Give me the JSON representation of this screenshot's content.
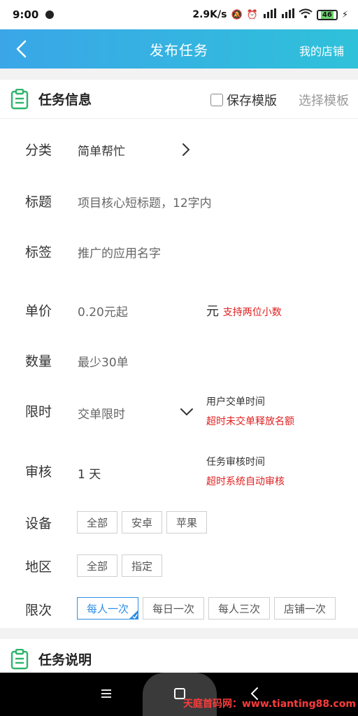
{
  "status_bar": {
    "time": "9:00",
    "speed": "2.9K/s",
    "battery": "46",
    "icons": [
      "dot-icon",
      "mute-icon",
      "alarm-icon",
      "signal-hd-icon",
      "signal-hd-icon",
      "wifi-icon",
      "battery-icon",
      "charging-icon"
    ]
  },
  "header": {
    "title": "发布任务",
    "right_link": "我的店铺",
    "back_icon": "chevron-left-icon",
    "gradient": [
      "#3aa6e8",
      "#2fc1da"
    ]
  },
  "task_info": {
    "title": "任务信息",
    "save_template": "保存模版",
    "save_template_checked": false,
    "choose_template": "选择模板"
  },
  "fields": {
    "category": {
      "label": "分类",
      "value": "简单帮忙"
    },
    "title": {
      "label": "标题",
      "placeholder": "项目核心短标题，12字内"
    },
    "tags": {
      "label": "标签",
      "placeholder": "推广的应用名字"
    },
    "price": {
      "label": "单价",
      "placeholder": "0.20元起",
      "unit": "元",
      "hint": "支持两位小数"
    },
    "quantity": {
      "label": "数量",
      "placeholder": "最少30单"
    },
    "time_limit": {
      "label": "限时",
      "placeholder": "交单限时",
      "hint_line1": "用户交单时间",
      "hint_line2": "超时未交单释放名额"
    },
    "review": {
      "label": "审核",
      "value": "1 天",
      "hint_line1": "任务审核时间",
      "hint_line2": "超时系统自动审核"
    },
    "device": {
      "label": "设备",
      "options": [
        "全部",
        "安卓",
        "苹果"
      ]
    },
    "region": {
      "label": "地区",
      "options": [
        "全部",
        "指定"
      ]
    },
    "frequency": {
      "label": "限次",
      "options": [
        "每人一次",
        "每日一次",
        "每人三次",
        "店铺一次"
      ],
      "selected": "每人一次"
    }
  },
  "task_desc": {
    "title": "任务说明"
  },
  "system_nav": {
    "icons": [
      "menu-icon",
      "home-icon",
      "back-icon"
    ],
    "watermark": "天庭首码网：www.tianting88.com"
  },
  "colors": {
    "accent": "#2f8ee5",
    "warning_red": "#e02020",
    "clipboard_green": "#2fb56b"
  }
}
